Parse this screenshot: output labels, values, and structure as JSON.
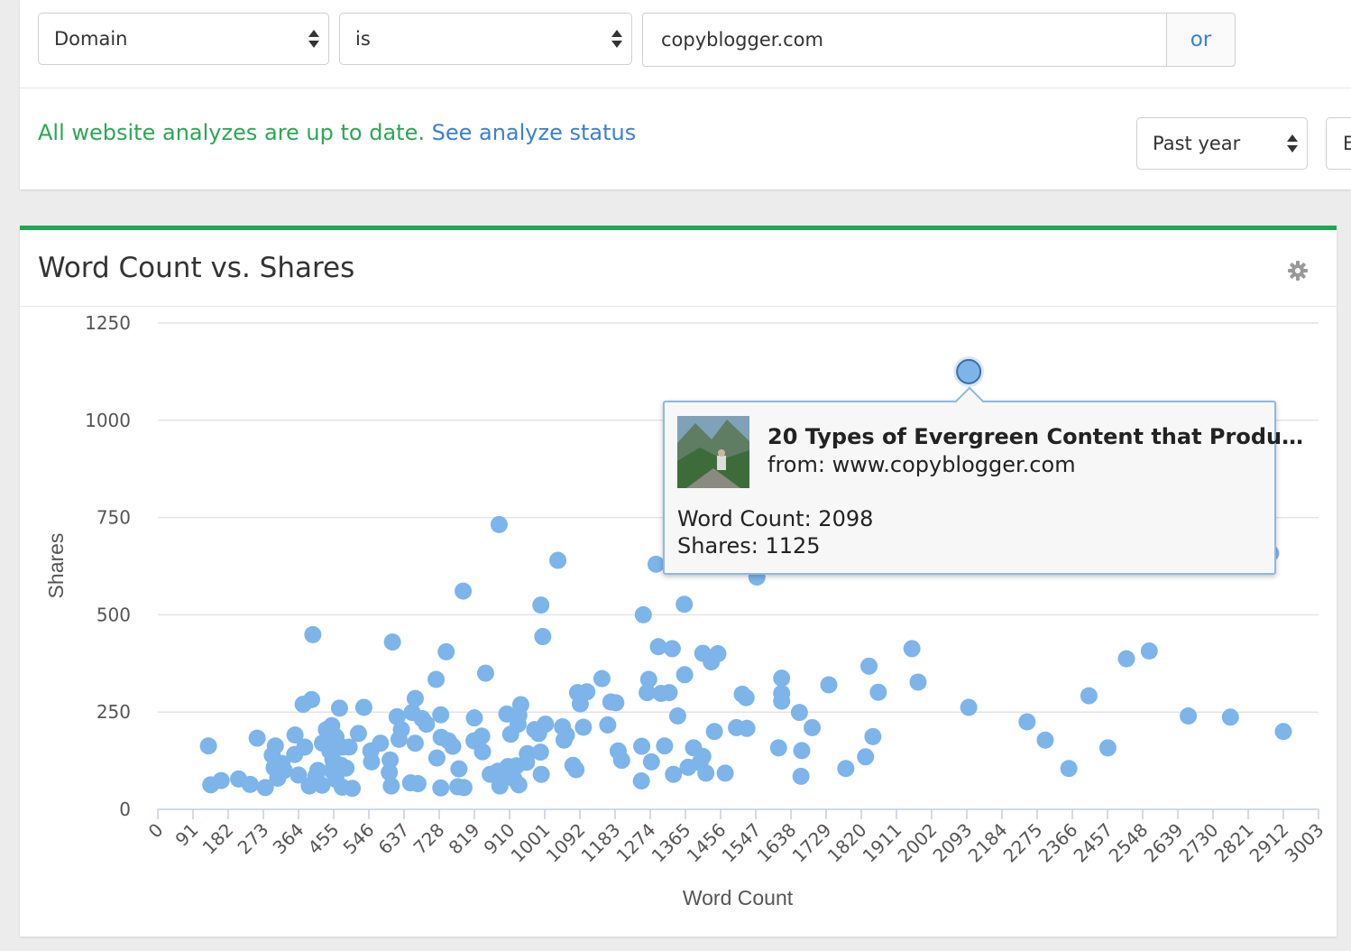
{
  "filters": {
    "field": "Domain",
    "operator": "is",
    "value": "copyblogger.com",
    "or_label": "or"
  },
  "status": {
    "message": "All website analyzes are up to date.",
    "link": "See analyze status"
  },
  "range_selects": [
    {
      "value": "Past year"
    },
    {
      "value": "E"
    }
  ],
  "chart_panel": {
    "title": "Word Count vs. Shares",
    "settings_icon": "gear-icon"
  },
  "tooltip": {
    "title": "20 Types of Evergreen Content that Produ…",
    "from": "from: www.copyblogger.com",
    "word_count": "Word Count: 2098",
    "shares": "Shares: 1125",
    "thumbnail_icon": "article-thumbnail"
  },
  "chart_data": {
    "type": "scatter",
    "title": "",
    "xlabel": "Word Count",
    "ylabel": "Shares",
    "xlim": [
      0,
      3003
    ],
    "ylim": [
      0,
      1250
    ],
    "x_ticks": [
      "0",
      "91",
      "182",
      "273",
      "364",
      "455",
      "546",
      "637",
      "728",
      "819",
      "910",
      "1001",
      "1092",
      "1183",
      "1274",
      "1365",
      "1456",
      "1547",
      "1638",
      "1729",
      "1820",
      "1911",
      "2002",
      "2093",
      "2184",
      "2275",
      "2366",
      "2457",
      "2548",
      "2639",
      "2730",
      "2821",
      "2912",
      "3003"
    ],
    "y_ticks": [
      "0",
      "250",
      "500",
      "750",
      "1000",
      "1250"
    ],
    "grid": true,
    "point_color": "#7db4ea",
    "highlighted": {
      "x": 2098,
      "y": 1125
    },
    "points": [
      [
        131,
        163
      ],
      [
        137,
        63
      ],
      [
        164,
        74
      ],
      [
        209,
        78
      ],
      [
        239,
        64
      ],
      [
        257,
        183
      ],
      [
        278,
        56
      ],
      [
        296,
        139
      ],
      [
        304,
        163
      ],
      [
        301,
        107
      ],
      [
        321,
        118
      ],
      [
        310,
        80
      ],
      [
        327,
        100
      ],
      [
        355,
        191
      ],
      [
        354,
        141
      ],
      [
        364,
        88
      ],
      [
        376,
        270
      ],
      [
        380,
        160
      ],
      [
        398,
        282
      ],
      [
        401,
        449
      ],
      [
        392,
        60
      ],
      [
        409,
        85
      ],
      [
        426,
        170
      ],
      [
        425,
        62
      ],
      [
        436,
        205
      ],
      [
        445,
        150
      ],
      [
        453,
        127
      ],
      [
        450,
        100
      ],
      [
        461,
        186
      ],
      [
        461,
        77
      ],
      [
        474,
        113
      ],
      [
        477,
        160
      ],
      [
        477,
        57
      ],
      [
        487,
        106
      ],
      [
        495,
        160
      ],
      [
        470,
        260
      ],
      [
        450,
        215
      ],
      [
        414,
        100
      ],
      [
        503,
        54
      ],
      [
        519,
        195
      ],
      [
        533,
        262
      ],
      [
        551,
        150
      ],
      [
        553,
        122
      ],
      [
        576,
        170
      ],
      [
        601,
        127
      ],
      [
        599,
        95
      ],
      [
        604,
        60
      ],
      [
        607,
        430
      ],
      [
        619,
        238
      ],
      [
        624,
        180
      ],
      [
        630,
        205
      ],
      [
        654,
        68
      ],
      [
        658,
        249
      ],
      [
        666,
        285
      ],
      [
        666,
        170
      ],
      [
        673,
        66
      ],
      [
        684,
        233
      ],
      [
        695,
        219
      ],
      [
        732,
        243
      ],
      [
        733,
        185
      ],
      [
        722,
        132
      ],
      [
        720,
        334
      ],
      [
        732,
        55
      ],
      [
        746,
        405
      ],
      [
        752,
        176
      ],
      [
        763,
        162
      ],
      [
        779,
        104
      ],
      [
        776,
        58
      ],
      [
        792,
        56
      ],
      [
        790,
        561
      ],
      [
        818,
        176
      ],
      [
        819,
        235
      ],
      [
        838,
        188
      ],
      [
        840,
        148
      ],
      [
        848,
        350
      ],
      [
        860,
        90
      ],
      [
        880,
        98
      ],
      [
        885,
        60
      ],
      [
        883,
        732
      ],
      [
        904,
        92
      ],
      [
        906,
        110
      ],
      [
        903,
        245
      ],
      [
        913,
        193
      ],
      [
        921,
        79
      ],
      [
        928,
        112
      ],
      [
        932,
        219
      ],
      [
        934,
        63
      ],
      [
        939,
        269
      ],
      [
        934,
        242
      ],
      [
        956,
        143
      ],
      [
        954,
        121
      ],
      [
        975,
        205
      ],
      [
        985,
        195
      ],
      [
        992,
        90
      ],
      [
        990,
        147
      ],
      [
        991,
        525
      ],
      [
        996,
        444
      ],
      [
        1003,
        219
      ],
      [
        1047,
        212
      ],
      [
        1051,
        178
      ],
      [
        1035,
        640
      ],
      [
        1057,
        191
      ],
      [
        1074,
        113
      ],
      [
        1082,
        102
      ],
      [
        1101,
        211
      ],
      [
        1086,
        300
      ],
      [
        1110,
        302
      ],
      [
        1093,
        271
      ],
      [
        1149,
        336
      ],
      [
        1172,
        276
      ],
      [
        1164,
        217
      ],
      [
        1185,
        274
      ],
      [
        1191,
        150
      ],
      [
        1200,
        126
      ],
      [
        1256,
        500
      ],
      [
        1252,
        162
      ],
      [
        1251,
        73
      ],
      [
        1270,
        334
      ],
      [
        1266,
        300
      ],
      [
        1277,
        122
      ],
      [
        1295,
        418
      ],
      [
        1289,
        630
      ],
      [
        1302,
        298
      ],
      [
        1323,
        300
      ],
      [
        1311,
        163
      ],
      [
        1331,
        413
      ],
      [
        1334,
        90
      ],
      [
        1345,
        240
      ],
      [
        1363,
        346
      ],
      [
        1362,
        527
      ],
      [
        1372,
        108
      ],
      [
        1386,
        158
      ],
      [
        1403,
        120
      ],
      [
        1410,
        136
      ],
      [
        1410,
        401
      ],
      [
        1418,
        93
      ],
      [
        1432,
        379
      ],
      [
        1440,
        200
      ],
      [
        1449,
        400
      ],
      [
        1468,
        93
      ],
      [
        1497,
        210
      ],
      [
        1512,
        296
      ],
      [
        1522,
        287
      ],
      [
        1524,
        208
      ],
      [
        1550,
        597
      ],
      [
        1606,
        158
      ],
      [
        1614,
        337
      ],
      [
        1614,
        298
      ],
      [
        1614,
        278
      ],
      [
        1660,
        249
      ],
      [
        1666,
        151
      ],
      [
        1664,
        85
      ],
      [
        1693,
        210
      ],
      [
        1736,
        320
      ],
      [
        1780,
        105
      ],
      [
        1831,
        135
      ],
      [
        1840,
        368
      ],
      [
        1850,
        187
      ],
      [
        1864,
        301
      ],
      [
        1951,
        413
      ],
      [
        1967,
        327
      ],
      [
        2098,
        262
      ],
      [
        2249,
        225
      ],
      [
        2296,
        178
      ],
      [
        2357,
        105
      ],
      [
        2409,
        292
      ],
      [
        2458,
        158
      ],
      [
        2506,
        387
      ],
      [
        2565,
        407
      ],
      [
        2666,
        240
      ],
      [
        2775,
        237
      ],
      [
        2912,
        200
      ],
      [
        2879,
        658
      ],
      [
        2098,
        1125
      ]
    ]
  }
}
